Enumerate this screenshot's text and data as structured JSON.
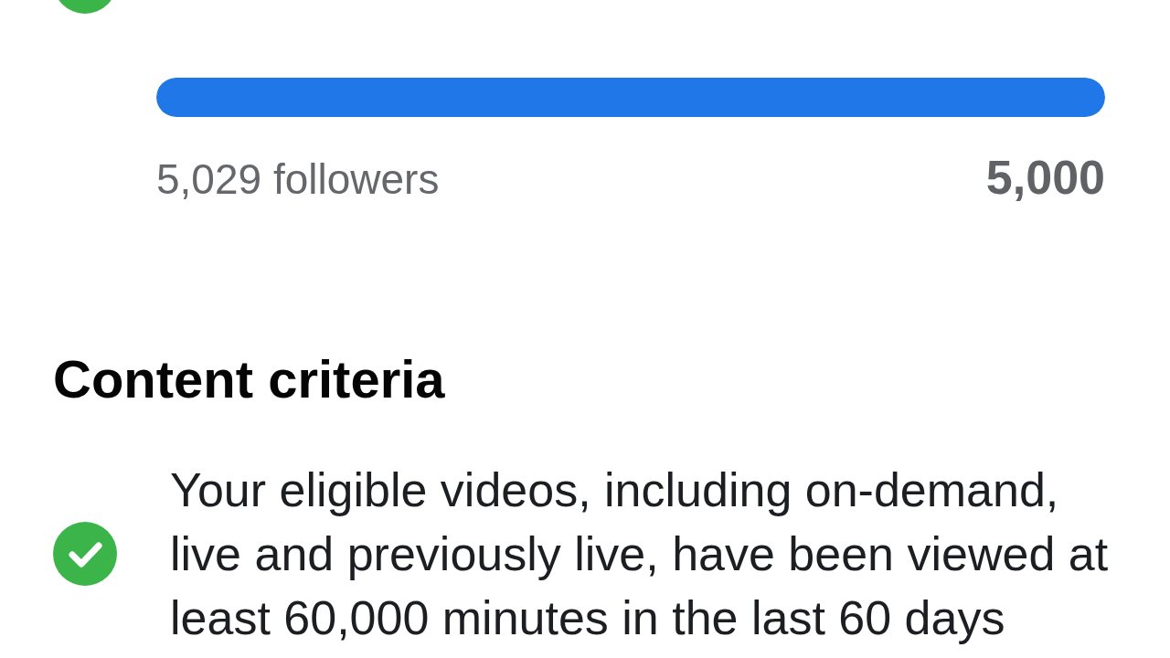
{
  "follower_criterion": {
    "met": true,
    "progress": {
      "level": 1,
      "current": "5,029 followers",
      "target": "5,000"
    }
  },
  "content_criteria": {
    "heading": "Content criteria",
    "items": [
      {
        "met": true,
        "text": "Your eligible videos, including on-demand, live and previously live, have been viewed at least 60,000 minutes in the last 60 days"
      }
    ]
  }
}
